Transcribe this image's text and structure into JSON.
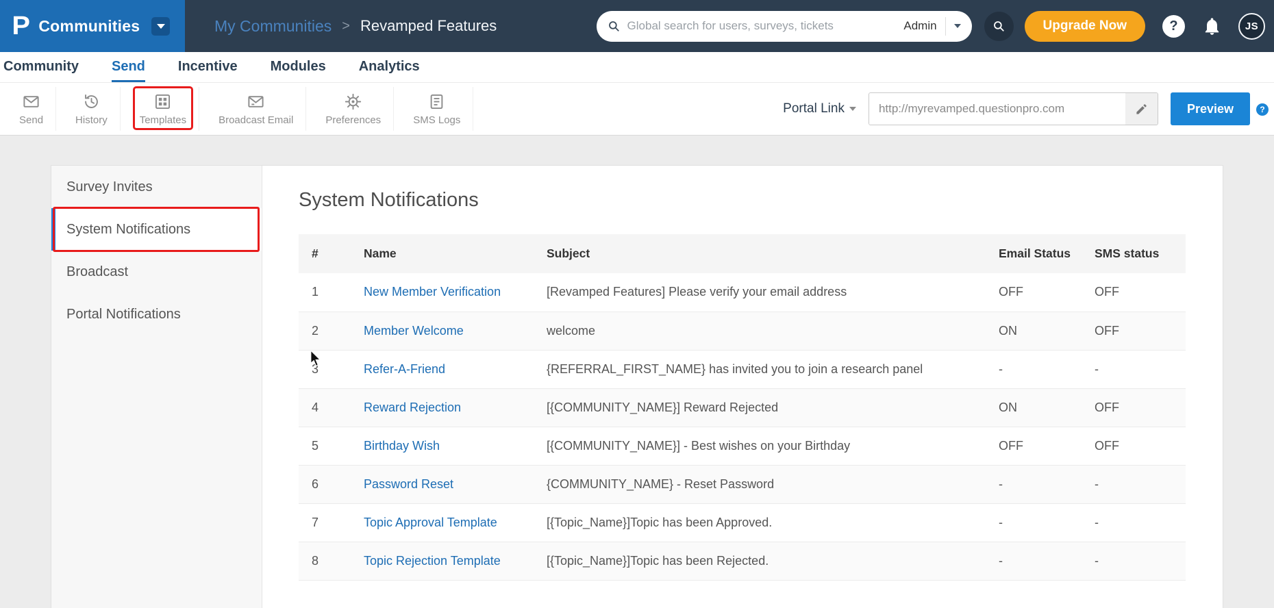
{
  "header": {
    "logo_letter": "P",
    "communities_label": "Communities",
    "breadcrumb": {
      "parent": "My Communities",
      "separator": ">",
      "current": "Revamped Features"
    },
    "search": {
      "placeholder": "Global search for users, surveys, tickets",
      "scope_label": "Admin"
    },
    "upgrade_label": "Upgrade Now",
    "help_label": "?",
    "avatar_initials": "JS"
  },
  "nav_tabs": [
    {
      "label": "Community"
    },
    {
      "label": "Send"
    },
    {
      "label": "Incentive"
    },
    {
      "label": "Modules"
    },
    {
      "label": "Analytics"
    }
  ],
  "toolbar": {
    "items": [
      {
        "label": "Send"
      },
      {
        "label": "History"
      },
      {
        "label": "Templates"
      },
      {
        "label": "Broadcast Email"
      },
      {
        "label": "Preferences"
      },
      {
        "label": "SMS Logs"
      }
    ],
    "portal_link_label": "Portal Link",
    "portal_url": "http://myrevamped.questionpro.com",
    "preview_label": "Preview",
    "tiny_help_label": "?"
  },
  "sidebar": {
    "items": [
      {
        "label": "Survey Invites"
      },
      {
        "label": "System Notifications"
      },
      {
        "label": "Broadcast"
      },
      {
        "label": "Portal Notifications"
      }
    ]
  },
  "main": {
    "title": "System Notifications",
    "table": {
      "headers": {
        "num": "#",
        "name": "Name",
        "subject": "Subject",
        "email": "Email Status",
        "sms": "SMS status"
      },
      "rows": [
        {
          "num": "1",
          "name": "New Member Verification",
          "subject": "[Revamped Features] Please verify your email address",
          "email": "OFF",
          "sms": "OFF"
        },
        {
          "num": "2",
          "name": "Member Welcome",
          "subject": "welcome",
          "email": "ON",
          "sms": "OFF"
        },
        {
          "num": "3",
          "name": "Refer-A-Friend",
          "subject": "{REFERRAL_FIRST_NAME} has invited you to join a research panel",
          "email": "-",
          "sms": "-"
        },
        {
          "num": "4",
          "name": "Reward Rejection",
          "subject": "[{COMMUNITY_NAME}] Reward Rejected",
          "email": "ON",
          "sms": "OFF"
        },
        {
          "num": "5",
          "name": "Birthday Wish",
          "subject": "[{COMMUNITY_NAME}] - Best wishes on your Birthday",
          "email": "OFF",
          "sms": "OFF"
        },
        {
          "num": "6",
          "name": "Password Reset",
          "subject": "{COMMUNITY_NAME} - Reset Password",
          "email": "-",
          "sms": "-"
        },
        {
          "num": "7",
          "name": "Topic Approval Template",
          "subject": "[{Topic_Name}]Topic has been Approved.",
          "email": "-",
          "sms": "-"
        },
        {
          "num": "8",
          "name": "Topic Rejection Template",
          "subject": "[{Topic_Name}]Topic has been Rejected.",
          "email": "-",
          "sms": "-"
        }
      ]
    }
  },
  "colors": {
    "header_bg": "#2d3e50",
    "brand_blue": "#1d6db4",
    "active_sidebar_blue": "#1b87e6",
    "link_blue": "#1d6db4",
    "upgrade_orange": "#f5a51d",
    "preview_blue": "#1b85d6",
    "annotation_red": "#e81c1c"
  }
}
